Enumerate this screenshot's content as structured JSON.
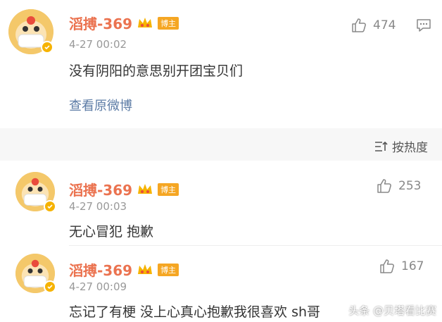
{
  "post": {
    "username": "滔搏-369",
    "badge": "博主",
    "time": "4-27 00:02",
    "text": "没有阴阳的意思别开团宝贝们",
    "view_original": "查看原微博",
    "like_count": "474"
  },
  "sort": {
    "label": "按热度"
  },
  "comments": [
    {
      "username": "滔搏-369",
      "badge": "博主",
      "time": "4-27 00:03",
      "text": "无心冒犯 抱歉",
      "like_count": "253"
    },
    {
      "username": "滔搏-369",
      "badge": "博主",
      "time": "4-27 00:09",
      "text": "忘记了有梗 没上心真心抱歉我很喜欢 sh哥",
      "like_count": "167"
    }
  ],
  "watermark": "头条 @贝塔看比赛",
  "colors": {
    "username": "#eb7350",
    "link": "#5d7ca6",
    "time": "#999999",
    "badge": "#f5a623"
  }
}
